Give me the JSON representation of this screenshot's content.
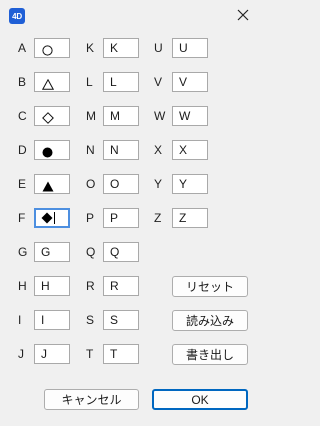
{
  "window": {
    "app_icon_text": "4D",
    "close_icon": "close-icon"
  },
  "columns": [
    {
      "rows": [
        {
          "label": "A",
          "value": "",
          "symbol": "circle-outline"
        },
        {
          "label": "B",
          "value": "",
          "symbol": "triangle-outline"
        },
        {
          "label": "C",
          "value": "",
          "symbol": "diamond-outline"
        },
        {
          "label": "D",
          "value": "",
          "symbol": "circle-filled"
        },
        {
          "label": "E",
          "value": "",
          "symbol": "triangle-filled"
        },
        {
          "label": "F",
          "value": "",
          "symbol": "diamond-filled",
          "focused": true
        },
        {
          "label": "G",
          "value": "G"
        },
        {
          "label": "H",
          "value": "H"
        },
        {
          "label": "I",
          "value": "I"
        },
        {
          "label": "J",
          "value": "J"
        }
      ]
    },
    {
      "rows": [
        {
          "label": "K",
          "value": "K"
        },
        {
          "label": "L",
          "value": "L"
        },
        {
          "label": "M",
          "value": "M"
        },
        {
          "label": "N",
          "value": "N"
        },
        {
          "label": "O",
          "value": "O"
        },
        {
          "label": "P",
          "value": "P"
        },
        {
          "label": "Q",
          "value": "Q"
        },
        {
          "label": "R",
          "value": "R"
        },
        {
          "label": "S",
          "value": "S"
        },
        {
          "label": "T",
          "value": "T"
        }
      ]
    },
    {
      "rows": [
        {
          "label": "U",
          "value": "U"
        },
        {
          "label": "V",
          "value": "V"
        },
        {
          "label": "W",
          "value": "W"
        },
        {
          "label": "X",
          "value": "X"
        },
        {
          "label": "Y",
          "value": "Y"
        },
        {
          "label": "Z",
          "value": "Z"
        }
      ]
    }
  ],
  "side_buttons": {
    "reset": "リセット",
    "load": "読み込み",
    "export": "書き出し"
  },
  "footer": {
    "cancel": "キャンセル",
    "ok": "OK"
  }
}
